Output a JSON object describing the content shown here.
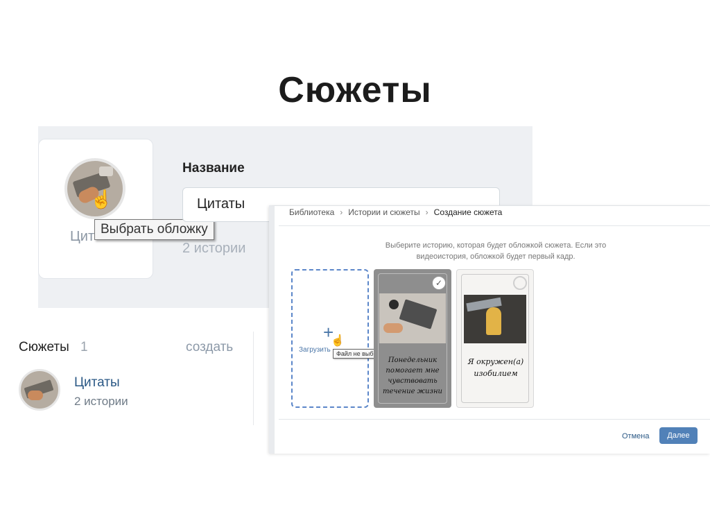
{
  "slide_title": "Сюжеты",
  "cover_editor": {
    "name_label": "Название",
    "name_value": "Цитаты",
    "cover_name_partial": "Цит",
    "stories_count": "2 истории",
    "tooltip": "Выбрать обложку"
  },
  "sidebar": {
    "heading": "Сюжеты",
    "count": "1",
    "create_link": "создать",
    "plot": {
      "name": "Цитаты",
      "stories": "2 истории"
    }
  },
  "dialog": {
    "breadcrumb": [
      "Библиотека",
      "Истории и сюжеты",
      "Создание сюжета"
    ],
    "hint": "Выберите историю, которая будет обложкой сюжета. Если это видеоистория, обложкой будет первый кадр.",
    "upload_label": "Загрузить",
    "file_tooltip": "Файл не выбран",
    "stories": [
      {
        "text": "Понедельник помогает мне чувствовать течение жизни",
        "selected": true
      },
      {
        "text": "Я окружен(а) изобилием",
        "selected": false
      }
    ],
    "cancel": "Отмена",
    "next": "Далее"
  },
  "icons": {
    "hand_cursor": "pointer-hand-icon",
    "plus": "plus-icon",
    "check": "check-icon",
    "chevron": "chevron-right-icon"
  },
  "colors": {
    "accent": "#5181b8",
    "link": "#2a5885",
    "dashed": "#5b86c9"
  }
}
